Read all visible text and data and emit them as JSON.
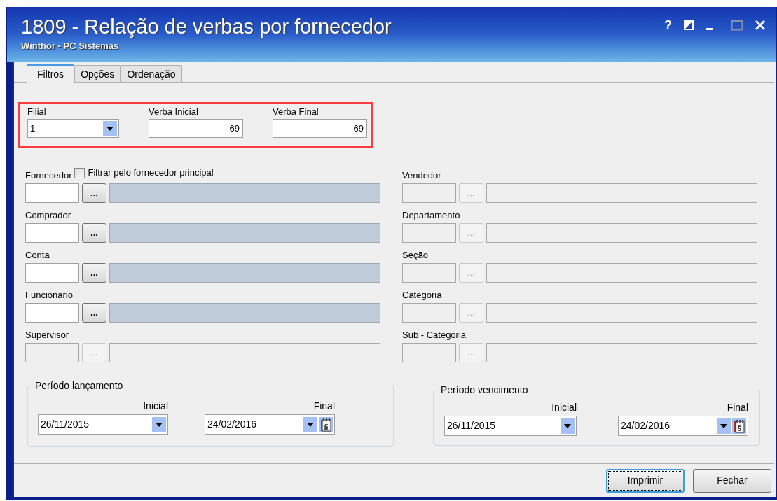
{
  "window": {
    "title": "1809 - Relação de verbas por fornecedor",
    "subtitle": "Winthor - PC Sistemas",
    "help_button": "?"
  },
  "tabs": [
    {
      "label": "Filtros",
      "selected": true
    },
    {
      "label": "Opções",
      "selected": false
    },
    {
      "label": "Ordenação",
      "selected": false
    }
  ],
  "main_filters": {
    "highlighted": true,
    "filial": {
      "label": "Filial",
      "value": "1"
    },
    "verba_inicial": {
      "label": "Verba Inicial",
      "value": "69"
    },
    "verba_final": {
      "label": "Verba Final",
      "value": "69"
    }
  },
  "lookups_left": [
    {
      "label": "Fornecedor",
      "button": "...",
      "disabled": false,
      "option": {
        "label": "Filtrar pelo fornecedor principal",
        "checked": false
      }
    },
    {
      "label": "Comprador",
      "button": "...",
      "disabled": false
    },
    {
      "label": "Conta",
      "button": "...",
      "disabled": false
    },
    {
      "label": "Funcionário",
      "button": "...",
      "disabled": false
    },
    {
      "label": "Supervisor",
      "button": "...",
      "disabled": true
    }
  ],
  "lookups_right": [
    {
      "label": "Vendedor",
      "button": "...",
      "disabled": true
    },
    {
      "label": "Departamento",
      "button": "...",
      "disabled": true
    },
    {
      "label": "Seção",
      "button": "...",
      "disabled": true
    },
    {
      "label": "Categoria",
      "button": "...",
      "disabled": true
    },
    {
      "label": "Sub - Categoria",
      "button": "...",
      "disabled": true
    }
  ],
  "periods": [
    {
      "title": "Período lançamento",
      "start": {
        "label": "Inicial",
        "value": "26/11/2015"
      },
      "end": {
        "label": "Final",
        "value": "24/02/2016"
      }
    },
    {
      "title": "Período vencimento",
      "start": {
        "label": "Inicial",
        "value": "26/11/2015"
      },
      "end": {
        "label": "Final",
        "value": "24/02/2016"
      }
    }
  ],
  "buttons": [
    {
      "label": "Imprimir",
      "focused": true
    },
    {
      "label": "Fechar",
      "focused": false
    }
  ]
}
